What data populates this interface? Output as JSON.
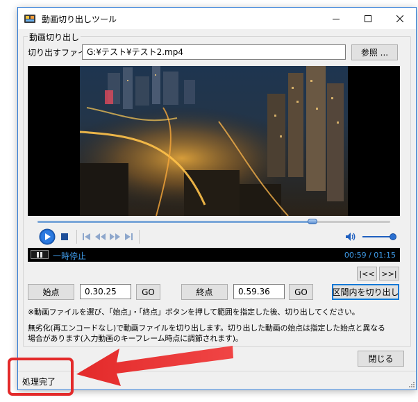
{
  "window": {
    "title": "動画切り出しツール",
    "controls": {
      "minimize": "—",
      "maximize": "☐",
      "close": "✕"
    }
  },
  "group": {
    "legend": "動画切り出し",
    "file_label": "切り出すファイル",
    "file_value": "G:¥テスト¥テスト2.mp4",
    "browse_label": "参照 ..."
  },
  "player": {
    "seek_fraction": 0.78,
    "volume_fraction": 0.92,
    "state_text": "一時停止",
    "time_text": "00:59 / 01:15"
  },
  "navigation": {
    "prev_label": "|<<",
    "next_label": ">>|"
  },
  "range": {
    "start_button": "始点",
    "start_value": "0.30.25",
    "start_go": "GO",
    "end_button": "終点",
    "end_value": "0.59.36",
    "end_go": "GO",
    "cut_button": "区間内を切り出し"
  },
  "notes": {
    "line1": "※動画ファイルを選び、「始点」・「終点」ボタンを押して範囲を指定した後、切り出してください。",
    "line2": "無劣化(再エンコードなし)で動画ファイルを切り出します。切り出した動画の始点は指定した始点と異なる",
    "line3": "場合があります(入力動画のキーフレーム時点に調節されます)。"
  },
  "footer": {
    "close_label": "閉じる",
    "status_text": "処理完了"
  },
  "colors": {
    "accent": "#0078d7",
    "player_text": "#3f9be8",
    "annotation": "#e32a2a"
  }
}
